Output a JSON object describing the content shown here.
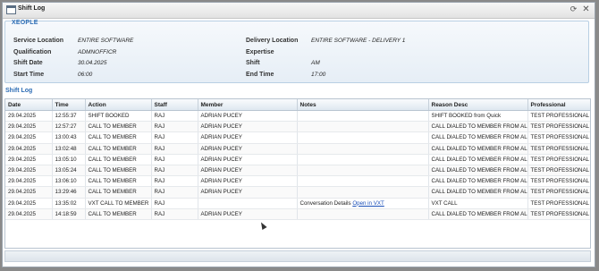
{
  "window": {
    "title": "Shift Log"
  },
  "info": {
    "legend": "XEOPLE",
    "fields": [
      {
        "label": "Service Location",
        "value": "ENTIRE SOFTWARE"
      },
      {
        "label": "Qualification",
        "value": "ADMNOFFICR"
      },
      {
        "label": "Shift Date",
        "value": "30.04.2025"
      },
      {
        "label": "Start Time",
        "value": "06:00"
      },
      {
        "label": "Delivery Location",
        "value": "ENTIRE SOFTWARE - DELIVERY 1"
      },
      {
        "label": "Expertise",
        "value": ""
      },
      {
        "label": "Shift",
        "value": "AM"
      },
      {
        "label": "End Time",
        "value": "17:00"
      }
    ]
  },
  "log": {
    "title": "Shift Log",
    "columns": [
      "Date",
      "Time",
      "Action",
      "Staff",
      "Member",
      "Notes",
      "Reason Desc",
      "Professional"
    ],
    "rows": [
      {
        "date": "29.04.2025",
        "time": "12:55:37",
        "action": "SHIFT BOOKED",
        "staff": "RAJ",
        "member": "ADRIAN PUCEY",
        "notes": "",
        "reason": "SHIFT BOOKED from Quick",
        "professional": "TEST PROFESSIONAL"
      },
      {
        "date": "29.04.2025",
        "time": "12:57:27",
        "action": "CALL TO MEMBER",
        "staff": "RAJ",
        "member": "ADRIAN PUCEY",
        "notes": "",
        "reason": "CALL DIALED TO MEMBER FROM ALLO",
        "professional": "TEST PROFESSIONAL"
      },
      {
        "date": "29.04.2025",
        "time": "13:00:43",
        "action": "CALL TO MEMBER",
        "staff": "RAJ",
        "member": "ADRIAN PUCEY",
        "notes": "",
        "reason": "CALL DIALED TO MEMBER FROM ALLO",
        "professional": "TEST PROFESSIONAL"
      },
      {
        "date": "29.04.2025",
        "time": "13:02:48",
        "action": "CALL TO MEMBER",
        "staff": "RAJ",
        "member": "ADRIAN PUCEY",
        "notes": "",
        "reason": "CALL DIALED TO MEMBER FROM ALLO",
        "professional": "TEST PROFESSIONAL"
      },
      {
        "date": "29.04.2025",
        "time": "13:05:10",
        "action": "CALL TO MEMBER",
        "staff": "RAJ",
        "member": "ADRIAN PUCEY",
        "notes": "",
        "reason": "CALL DIALED TO MEMBER FROM ALLO",
        "professional": "TEST PROFESSIONAL"
      },
      {
        "date": "29.04.2025",
        "time": "13:05:24",
        "action": "CALL TO MEMBER",
        "staff": "RAJ",
        "member": "ADRIAN PUCEY",
        "notes": "",
        "reason": "CALL DIALED TO MEMBER FROM ALLO",
        "professional": "TEST PROFESSIONAL"
      },
      {
        "date": "29.04.2025",
        "time": "13:06:10",
        "action": "CALL TO MEMBER",
        "staff": "RAJ",
        "member": "ADRIAN PUCEY",
        "notes": "",
        "reason": "CALL DIALED TO MEMBER FROM ALLO",
        "professional": "TEST PROFESSIONAL"
      },
      {
        "date": "29.04.2025",
        "time": "13:29:46",
        "action": "CALL TO MEMBER",
        "staff": "RAJ",
        "member": "ADRIAN PUCEY",
        "notes": "",
        "reason": "CALL DIALED TO MEMBER FROM ALLO",
        "professional": "TEST PROFESSIONAL"
      },
      {
        "date": "29.04.2025",
        "time": "13:35:02",
        "action": "VXT CALL TO MEMBER",
        "staff": "RAJ",
        "member": "",
        "notes": "Conversation Details",
        "notes_link": "Open in VXT",
        "reason": "VXT CALL",
        "professional": "TEST PROFESSIONAL"
      },
      {
        "date": "29.04.2025",
        "time": "14:18:59",
        "action": "CALL TO MEMBER",
        "staff": "RAJ",
        "member": "ADRIAN PUCEY",
        "notes": "",
        "reason": "CALL DIALED TO MEMBER FROM ALLO",
        "professional": "TEST PROFESSIONAL"
      }
    ]
  },
  "icons": {
    "window": "window-icon",
    "refresh": "refresh-icon",
    "close": "close-icon"
  }
}
